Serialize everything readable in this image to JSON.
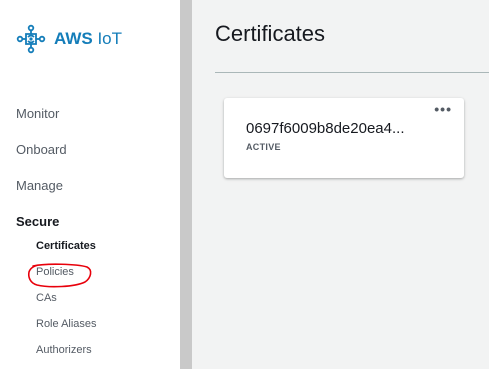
{
  "sidebar": {
    "brand": {
      "name_bold": "AWS",
      "name_rest": " IoT",
      "icon": "aws-iot-logo-icon",
      "color": "#147db9"
    },
    "items": [
      {
        "label": "Monitor"
      },
      {
        "label": "Onboard"
      },
      {
        "label": "Manage"
      },
      {
        "label": "Secure"
      }
    ],
    "secure_subitems": [
      {
        "label": "Certificates"
      },
      {
        "label": "Policies"
      },
      {
        "label": "CAs"
      },
      {
        "label": "Role Aliases"
      },
      {
        "label": "Authorizers"
      }
    ]
  },
  "main": {
    "title": "Certificates",
    "certificates": [
      {
        "id": "0697f6009b8de20ea4...",
        "status": "ACTIVE",
        "menu_icon": "more-options-icon"
      }
    ]
  },
  "colors": {
    "brand": "#147db9",
    "annotation": "#e8000b",
    "page_background": "#f2f3f3"
  }
}
